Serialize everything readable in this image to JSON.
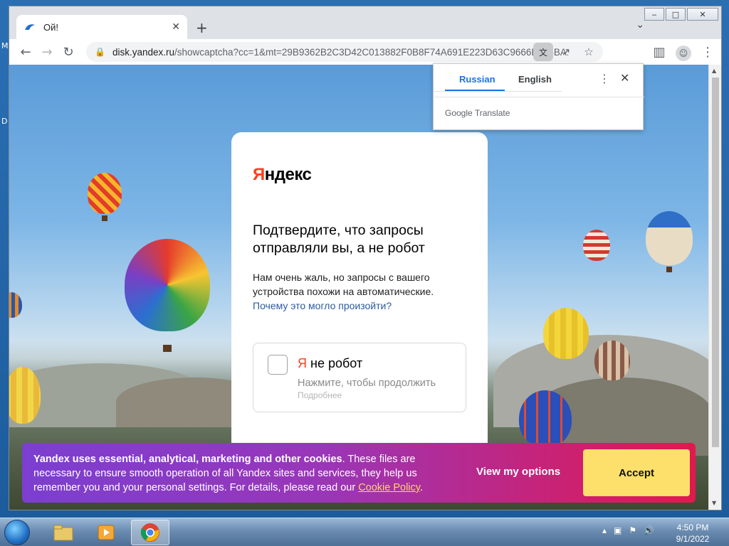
{
  "window": {
    "minimize": "‒",
    "maximize": "□",
    "close": "✕"
  },
  "tab": {
    "title": "Ой!",
    "close": "✕"
  },
  "toolbar": {
    "url_domain": "disk.yandex.ru",
    "url_path": "/showcaptcha?cc=1&mt=29B9362B2C3D42C013882F0B8F74A691E223D63C9666E043BA..."
  },
  "translate_popup": {
    "tab_source": "Russian",
    "tab_target": "English",
    "brand": "Google Translate"
  },
  "captcha": {
    "logo_first": "Я",
    "logo_rest": "ндекс",
    "heading": "Подтвердите, что запросы отправляли вы, а не робот",
    "body": "Нам очень жаль, но запросы с вашего устройства похожи на автоматические. ",
    "why_link": "Почему это могло произойти?",
    "robot_first": "Я",
    "robot_rest": " не робот",
    "robot_hint": "Нажмите, чтобы продолжить",
    "robot_more": "Подробнее"
  },
  "cookie_banner": {
    "lead": "Yandex uses essential, analytical, marketing and other cookies",
    "text": ". These files are necessary to ensure smooth operation of all Yandex sites and services, they help us remember you and your personal settings. For details, please read our ",
    "link": "Cookie Policy",
    "end": ".",
    "view_options": "View my options",
    "accept": "Accept"
  },
  "taskbar": {
    "time": "4:50 PM",
    "date": "9/1/2022"
  },
  "desktop": {
    "left_glyph_1": "M",
    "left_glyph_2": "D"
  },
  "colors": {
    "yandex_red": "#fc3f1d",
    "link_blue": "#2c5aa0",
    "accept_yellow": "#fde06b",
    "cookie_link": "#ffd75a"
  }
}
